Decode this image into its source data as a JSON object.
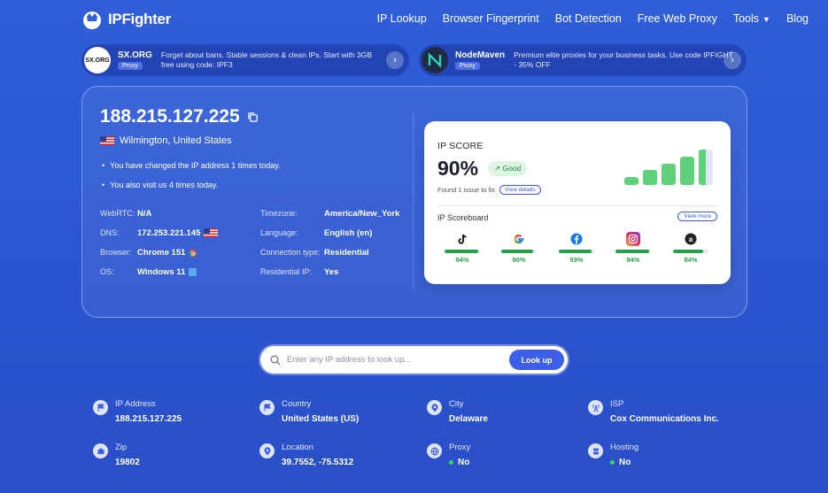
{
  "nav": {
    "brand": "IPFighter",
    "links": [
      "IP Lookup",
      "Browser Fingerprint",
      "Bot Detection",
      "Free Web Proxy",
      "Tools",
      "Blog"
    ]
  },
  "promos": [
    {
      "logo_text": "SX.ORG",
      "brand": "SX.ORG",
      "badge": "Proxy",
      "text": "Forget about bans. Stable sessions & clean IPs. Start with 3GB free using code: IPF3"
    },
    {
      "logo_text": "",
      "brand": "NodeMaven",
      "badge": "Proxy",
      "text": "Premium elite proxies for your business tasks. Use code IPFIGHT - 35% OFF"
    }
  ],
  "ip": {
    "address": "188.215.127.225",
    "location": "Wilmington, United States",
    "bullet_1": "You have changed the IP address 1 times today.",
    "bullet_2": "You also visit us 4 times today."
  },
  "info": {
    "webrtc_label": "WebRTC:",
    "webrtc": "N/A",
    "dns_label": "DNS:",
    "dns": "172.253.221.145",
    "browser_label": "Browser:",
    "browser": "Chrome 151",
    "os_label": "OS:",
    "os": "Windows 11",
    "timezone_label": "Timezone:",
    "timezone": "America/New_York",
    "language_label": "Language:",
    "language": "English (en)",
    "conn_label": "Connection type:",
    "conn": "Residential",
    "resip_label": "Residential IP:",
    "resip": "Yes"
  },
  "score": {
    "title": "IP SCORE",
    "value": "90%",
    "status": "Good",
    "issue": "Found 1 issue to fix",
    "view_details": "View details",
    "bar_levels": [
      0.22,
      0.42,
      0.6,
      0.8,
      1.0
    ],
    "scoreboard_title": "IP Scoreboard",
    "view_more": "View more",
    "items": [
      {
        "name": "tiktok",
        "pct": "94%",
        "value": 0.94
      },
      {
        "name": "google",
        "pct": "90%",
        "value": 0.9
      },
      {
        "name": "facebook",
        "pct": "93%",
        "value": 0.93
      },
      {
        "name": "instagram",
        "pct": "94%",
        "value": 0.94
      },
      {
        "name": "amazon",
        "pct": "84%",
        "value": 0.84
      }
    ]
  },
  "search": {
    "placeholder": "Enter any IP address to look up...",
    "button": "Look up"
  },
  "details": {
    "ip_label": "IP Address",
    "ip_value": "188.215.127.225",
    "country_label": "Country",
    "country_value": "United States (US)",
    "city_label": "City",
    "city_value": "Delaware",
    "isp_label": "ISP",
    "isp_value": "Cox Communications Inc.",
    "zip_label": "Zip",
    "zip_value": "19802",
    "location_label": "Location",
    "location_value": "39.7552, -75.5312",
    "proxy_label": "Proxy",
    "proxy_value": "No",
    "hosting_label": "Hosting",
    "hosting_value": "No"
  },
  "colors": {
    "good": "#27a04c",
    "accent": "#3d5ee8"
  }
}
